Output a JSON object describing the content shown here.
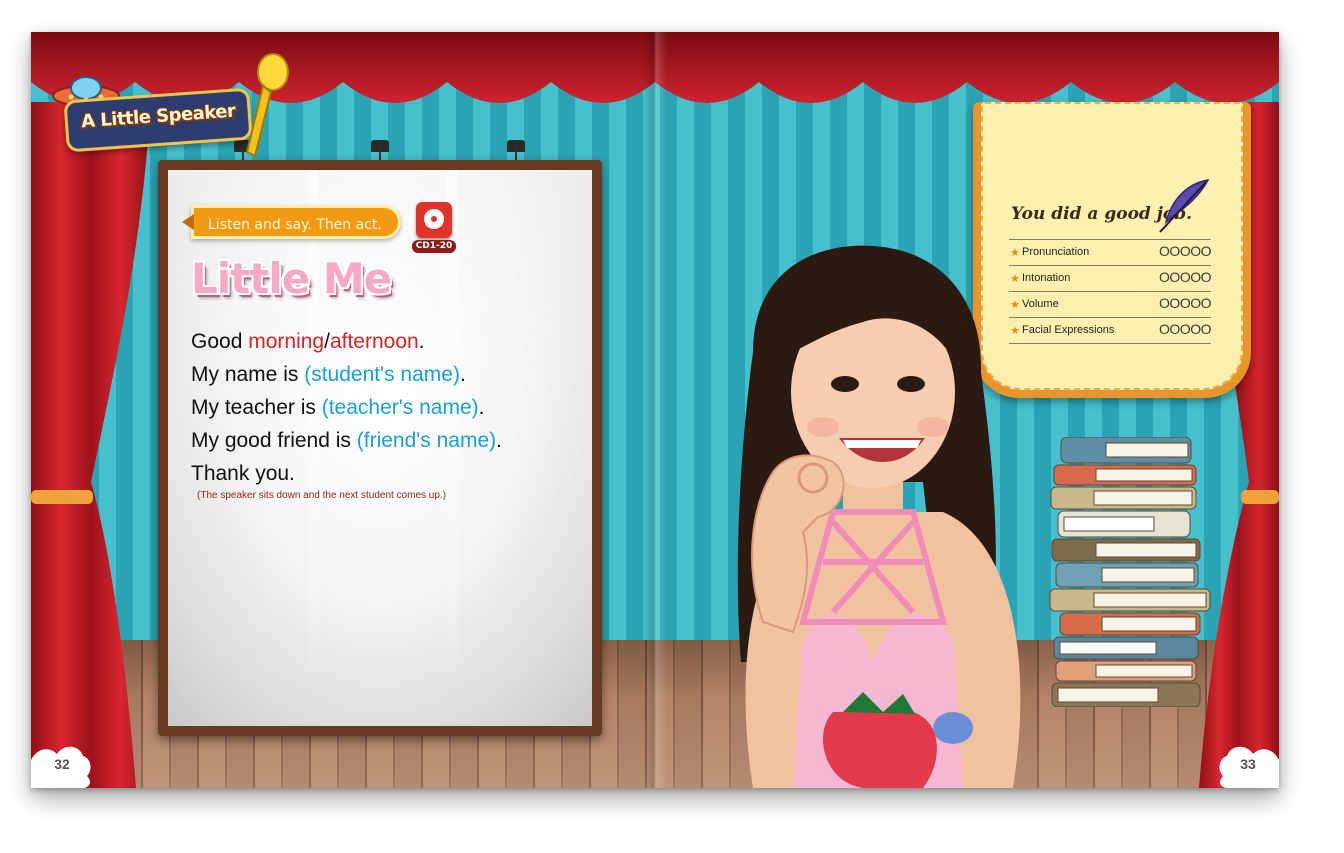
{
  "badge": {
    "title": "A Little Speaker"
  },
  "board": {
    "instruction": "Listen and say. Then act.",
    "cd_label": "CD1-20",
    "title": "Little Me",
    "lines": {
      "l1_a": "Good ",
      "l1_b": "morning",
      "l1_c": "/",
      "l1_d": "afternoon",
      "l1_e": ".",
      "l2_a": "My name is ",
      "l2_b": "(student's name)",
      "l2_c": ".",
      "l3_a": "My teacher is ",
      "l3_b": "(teacher's name)",
      "l3_c": ".",
      "l4_a": "My good friend is ",
      "l4_b": "(friend's name)",
      "l4_c": ".",
      "l5": "Thank you."
    },
    "note": "(The speaker sits down and the next student comes up.)"
  },
  "score_card": {
    "title": "You did a good job.",
    "rows": [
      {
        "label": "Pronunciation",
        "rating": "OOOOO"
      },
      {
        "label": "Intonation",
        "rating": "OOOOO"
      },
      {
        "label": "Volume",
        "rating": "OOOOO"
      },
      {
        "label": "Facial Expressions",
        "rating": "OOOOO"
      }
    ]
  },
  "pages": {
    "left": "32",
    "right": "33"
  },
  "colors": {
    "curtain": "#c8202a",
    "wall_light": "#45c0cc",
    "wall_dark": "#2aa3b3",
    "accent_orange": "#f29a12",
    "highlight_red": "#d42424",
    "highlight_blue": "#1aa0d8"
  },
  "icons": [
    "ufo-icon",
    "microphone-icon",
    "cd-audio-icon",
    "feather-quill-icon",
    "star-icon"
  ]
}
